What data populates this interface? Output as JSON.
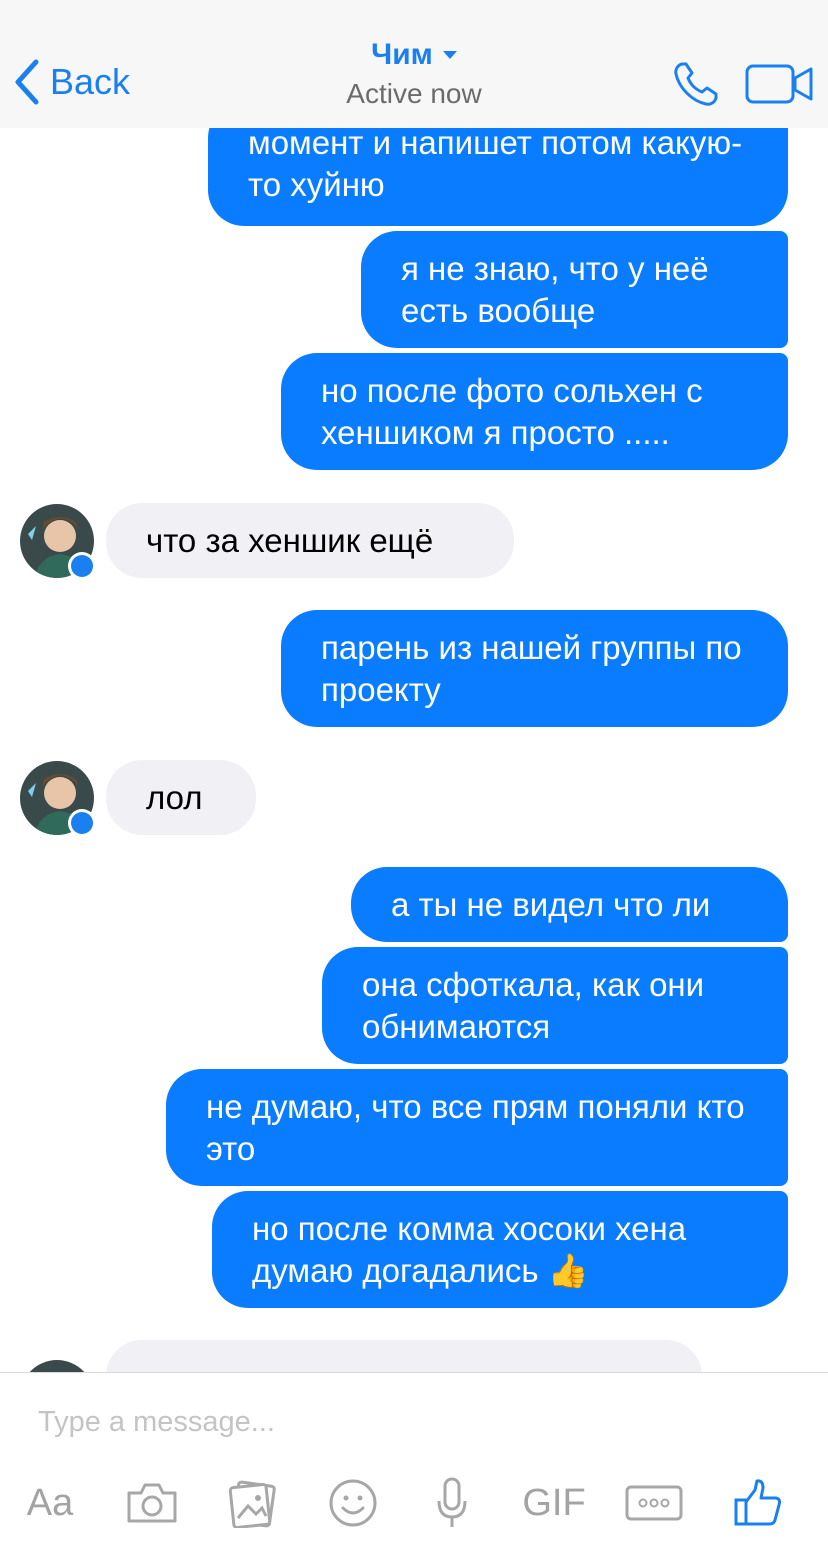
{
  "header": {
    "back_label": "Back",
    "contact_name": "Чим",
    "status": "Active now"
  },
  "messages": [
    {
      "dir": "out",
      "text": "момент и напишет потом какую-то хуйню"
    },
    {
      "dir": "out",
      "text": "я не знаю, что у неё есть вообще"
    },
    {
      "dir": "out",
      "text": "но после фото сольхен с хеншиком я просто ....."
    },
    {
      "dir": "in",
      "text": "что за хеншик ещё"
    },
    {
      "dir": "out",
      "text": "парень из нашей группы по проекту"
    },
    {
      "dir": "in",
      "text": "лол"
    },
    {
      "dir": "out",
      "text": "а ты не видел что ли"
    },
    {
      "dir": "out",
      "text": "она сфоткала, как они обнимаются"
    },
    {
      "dir": "out",
      "text": "не думаю, что все прям поняли кто это"
    },
    {
      "dir": "out",
      "text": "но после комма хосоки хена думаю догадались",
      "emoji": "👍"
    }
  ],
  "composer": {
    "placeholder": "Type a message...",
    "tools": [
      "Aa",
      "camera-icon",
      "photo-gallery-icon",
      "smiley-icon",
      "microphone-icon",
      "GIF",
      "more-icon",
      "thumbs-up-icon"
    ]
  },
  "colors": {
    "accent": "#0a7cff",
    "incoming_bubble": "#f1f0f5",
    "header_bg": "#f7f7f7"
  }
}
